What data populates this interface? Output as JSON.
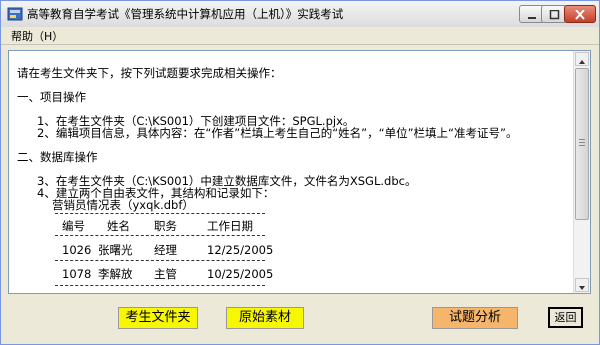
{
  "window": {
    "title": "高等教育自学考试《管理系统中计算机应用（上机）》实践考试"
  },
  "menu": {
    "help_label": "帮助（H）"
  },
  "content": {
    "intro": "请在考生文件夹下，按下列试题要求完成相关操作：",
    "section1_title": "一、项目操作",
    "item1": "1、在考生文件夹（C:\\KS001）下创建项目文件：SPGL.pjx。",
    "item2": "2、编辑项目信息，具体内容：在“作者”栏填上考生自己的“姓名”，“单位”栏填上“准考证号”。",
    "section2_title": "二、数据库操作",
    "item3": "3、在考生文件夹（C:\\KS001）中建立数据库文件，文件名为XSGL.dbc。",
    "item4": "4、建立两个自由表文件，其结构和记录如下：",
    "table_title": "营销员情况表（yxqk.dbf）",
    "table_headers": [
      "编号",
      "姓名",
      "职务",
      "工作日期"
    ],
    "table_rows": [
      [
        "1026",
        "张曙光",
        "经理",
        "12/25/2005"
      ],
      [
        "1078",
        "李解放",
        "主管",
        "10/25/2005"
      ]
    ]
  },
  "buttons": {
    "student_folder": "考生文件夹",
    "original_material": "原始素材",
    "analysis": "试题分析",
    "return": "返回"
  },
  "colors": {
    "yellow_button": "#f7f700",
    "orange_button": "#f5b56b"
  }
}
